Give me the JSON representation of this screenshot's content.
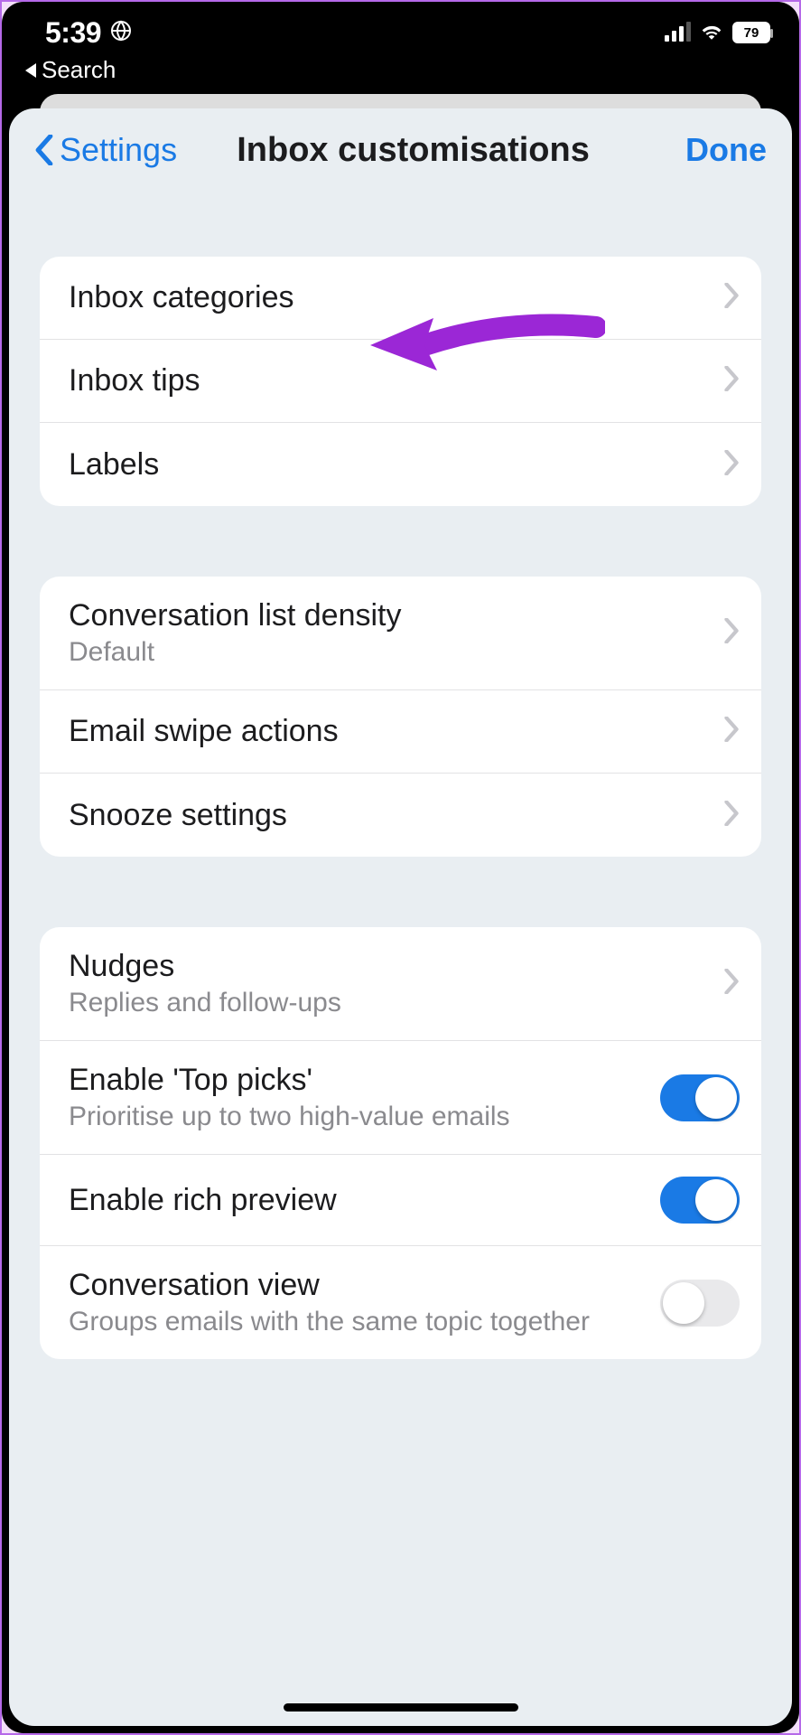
{
  "status_bar": {
    "time": "5:39",
    "battery_percent": "79",
    "back_label": "Search"
  },
  "nav": {
    "back_label": "Settings",
    "title": "Inbox customisations",
    "done_label": "Done"
  },
  "group1": {
    "items": [
      {
        "title": "Inbox categories"
      },
      {
        "title": "Inbox tips"
      },
      {
        "title": "Labels"
      }
    ]
  },
  "group2": {
    "items": [
      {
        "title": "Conversation list density",
        "subtitle": "Default"
      },
      {
        "title": "Email swipe actions"
      },
      {
        "title": "Snooze settings"
      }
    ]
  },
  "group3": {
    "items": [
      {
        "title": "Nudges",
        "subtitle": "Replies and follow-ups",
        "accessory": "chevron"
      },
      {
        "title": "Enable 'Top picks'",
        "subtitle": "Prioritise up to two high-value emails",
        "accessory": "toggle",
        "toggle_on": true
      },
      {
        "title": "Enable rich preview",
        "accessory": "toggle",
        "toggle_on": true
      },
      {
        "title": "Conversation view",
        "subtitle": "Groups emails with the same topic together",
        "accessory": "toggle",
        "toggle_on": false
      }
    ]
  }
}
